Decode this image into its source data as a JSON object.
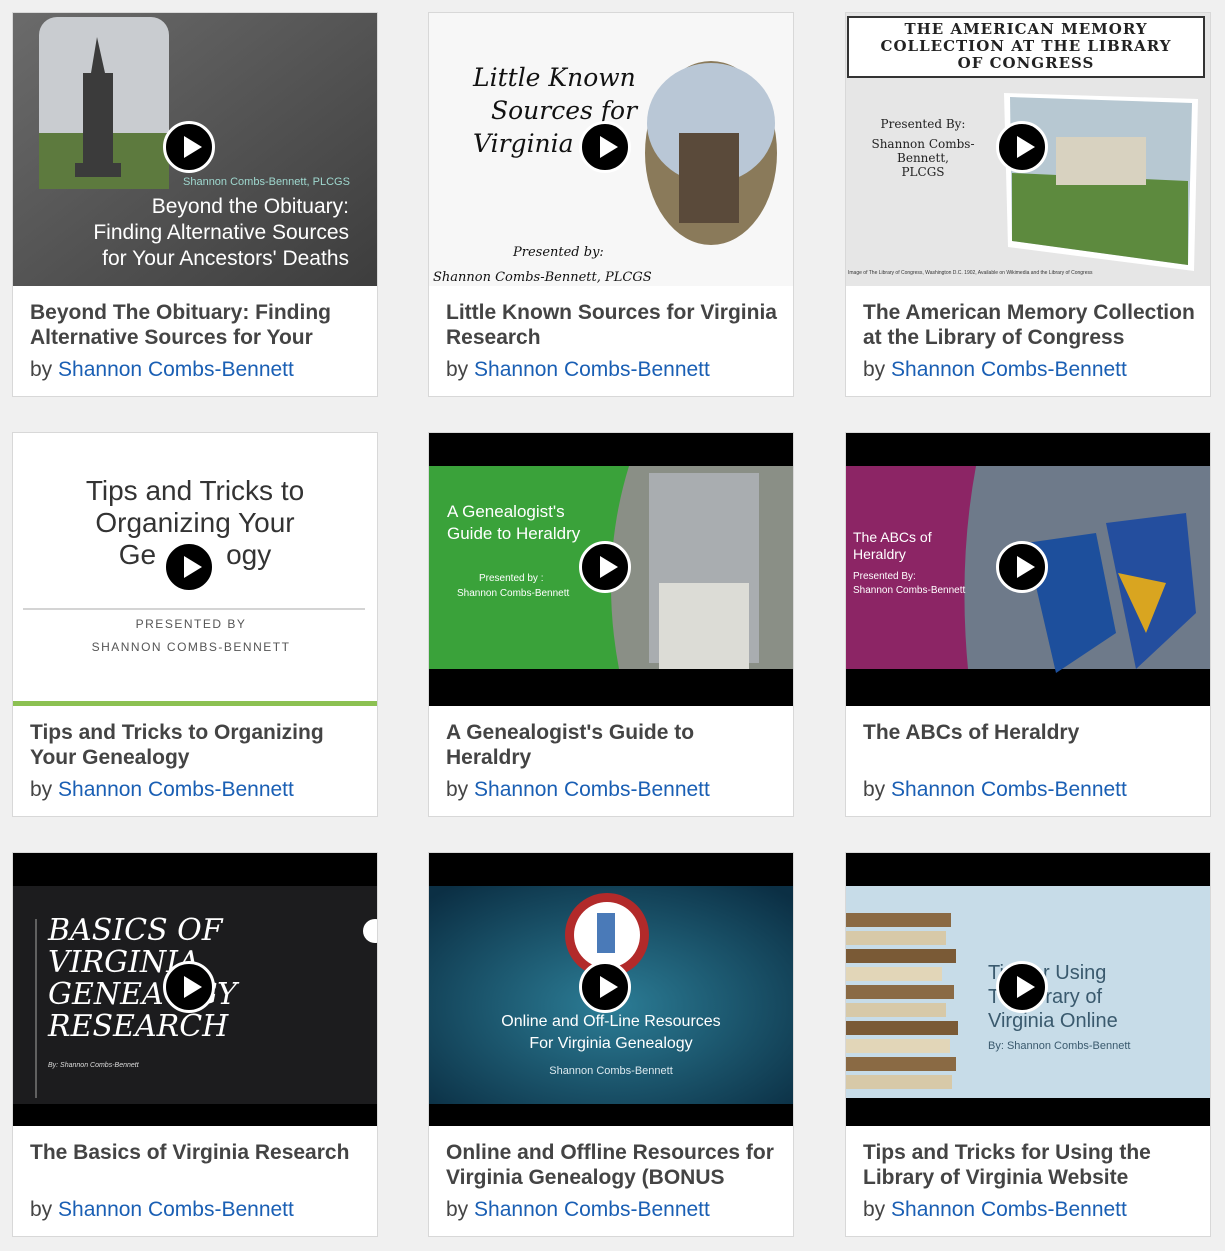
{
  "cards": [
    {
      "title": "Beyond The Obituary: Finding Alternative Sources for Your",
      "by": "by",
      "author": "Shannon Combs-Bennett",
      "thumb_text": {
        "presenter": "Shannon Combs-Bennett, PLCGS",
        "line1": "Beyond the Obituary:",
        "line2": "Finding Alternative Sources",
        "line3": "for Your Ancestors' Deaths"
      }
    },
    {
      "title": "Little Known Sources for Virginia Research",
      "by": "by",
      "author": "Shannon Combs-Bennett",
      "thumb_text": {
        "line1": "Little Known",
        "line2": "Sources for",
        "line3": "Virginia Re",
        "presented": "Presented by:",
        "presenter": "Shannon Combs-Bennett, PLCGS"
      }
    },
    {
      "title": "The American Memory Collection at the Library of Congress",
      "by": "by",
      "author": "Shannon Combs-Bennett",
      "thumb_text": {
        "line1": "THE AMERICAN MEMORY",
        "line2": "COLLECTION AT THE LIBRARY",
        "line3": "OF CONGRESS",
        "presented": "Presented By:",
        "presenter": "Shannon Combs-Bennett,",
        "credential": "PLCGS",
        "caption": "Image of The Library of Congress, Washington D.C. 1902, Available on Wikimedia and the Library of Congress"
      }
    },
    {
      "title": "Tips and Tricks to Organizing Your Genealogy",
      "by": "by",
      "author": "Shannon Combs-Bennett",
      "thumb_text": {
        "line1": "Tips and Tricks to",
        "line2": "Organizing Your",
        "line3a": "Ge",
        "line3b": "ogy",
        "presented": "PRESENTED BY",
        "presenter": "SHANNON COMBS-BENNETT"
      }
    },
    {
      "title": "A Genealogist's Guide to Heraldry",
      "by": "by",
      "author": "Shannon Combs-Bennett",
      "thumb_text": {
        "line1": "A Genealogist's",
        "line2": "Guide to Heraldry",
        "presented": "Presented by :",
        "presenter": "Shannon Combs-Bennett"
      }
    },
    {
      "title": "The ABCs of Heraldry",
      "by": "by",
      "author": "Shannon Combs-Bennett",
      "thumb_text": {
        "line1": "The ABCs of",
        "line2": "Heraldry",
        "presented": "Presented By:",
        "presenter": "Shannon Combs-Bennett"
      }
    },
    {
      "title": "The Basics of Virginia Research",
      "by": "by",
      "author": "Shannon Combs-Bennett",
      "thumb_text": {
        "line1": "BASICS OF",
        "line2": "VIRGINIA",
        "line3": "GENEA",
        "line3b": "GY",
        "line4": "RESEARCH",
        "presenter": "By: Shannon Combs-Bennett"
      }
    },
    {
      "title": "Online and Offline Resources for Virginia Genealogy (BONUS",
      "by": "by",
      "author": "Shannon Combs-Bennett",
      "thumb_text": {
        "line1": "Online and Off-Line Resources",
        "line2": "For Virginia Genealogy",
        "presenter": "Shannon Combs-Bennett"
      }
    },
    {
      "title": "Tips and Tricks for Using the Library of Virginia Website",
      "by": "by",
      "author": "Shannon Combs-Bennett",
      "thumb_text": {
        "line1a": "Ti",
        "line1b": "or Using",
        "line2a": "T",
        "line2b": "brary of",
        "line3": "Virginia Online",
        "presenter": "By: Shannon Combs-Bennett"
      }
    }
  ],
  "colors": {
    "author_link": "#1a5fb4",
    "title_text": "#444444",
    "page_bg": "#f0f0f0"
  },
  "icons": {
    "play": "play-button-icon"
  }
}
